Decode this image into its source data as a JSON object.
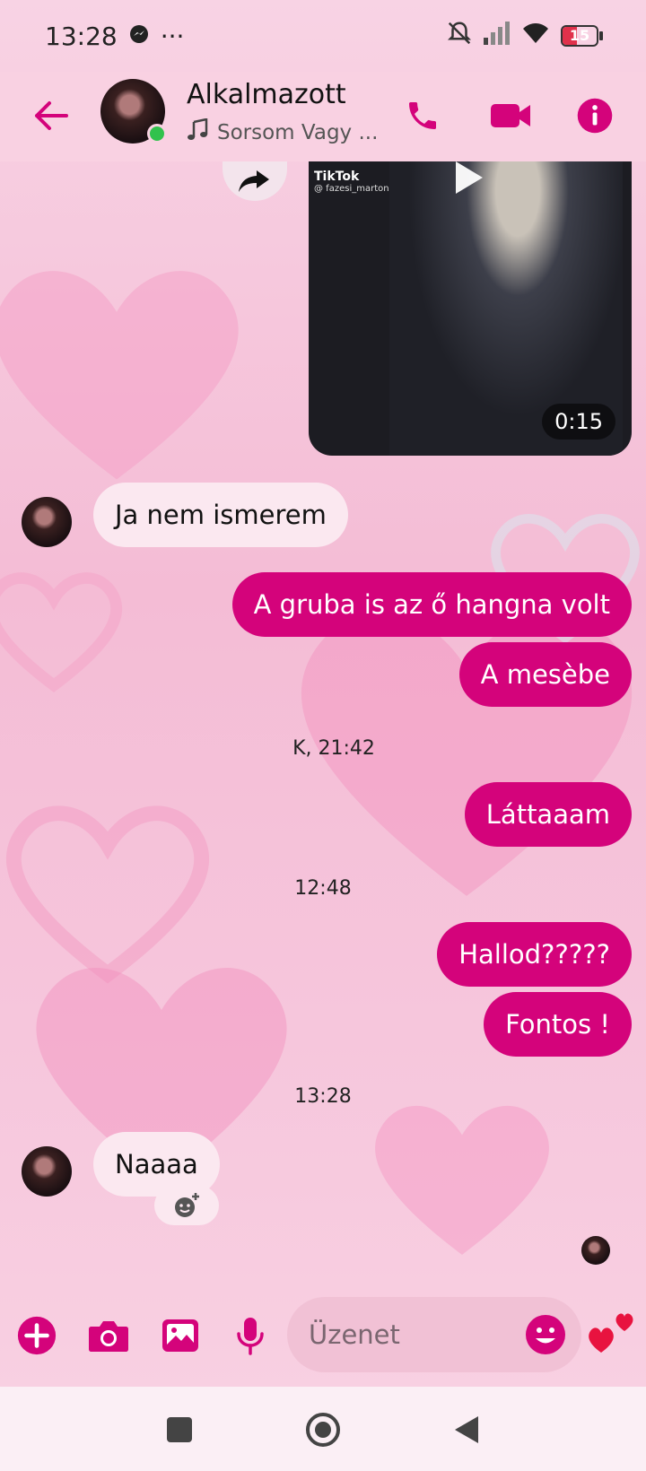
{
  "status_bar": {
    "time": "13:28",
    "more": "···",
    "battery": "15"
  },
  "header": {
    "title": "Alkalmazott",
    "subtitle": "Sorsom Vagy ...",
    "accent": "#d4037b"
  },
  "video": {
    "brand": "TikTok",
    "handle": "@ fazesi_marton",
    "duration": "0:15"
  },
  "messages": [
    {
      "direction": "in",
      "text": "Ja nem ismerem"
    },
    {
      "direction": "out",
      "text": "A gruba is az ő hangna volt"
    },
    {
      "direction": "out",
      "text": "A mesèbe"
    },
    {
      "type": "timestamp",
      "text": "K, 21:42"
    },
    {
      "direction": "out",
      "text": "Láttaaam"
    },
    {
      "type": "timestamp",
      "text": "12:48"
    },
    {
      "direction": "out",
      "text": "Hallod?????"
    },
    {
      "direction": "out",
      "text": "Fontos !"
    },
    {
      "type": "timestamp",
      "text": "13:28"
    },
    {
      "direction": "in",
      "text": "Naaaa"
    }
  ],
  "composer": {
    "placeholder": "Üzenet"
  },
  "colors": {
    "outgoing_bubble": "#d4037b",
    "incoming_bubble": "#fbe8f0",
    "online": "#31c24d"
  }
}
